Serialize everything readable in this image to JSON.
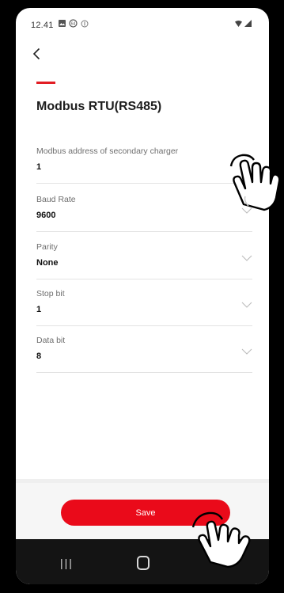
{
  "status_bar": {
    "time": "12.41",
    "icons": [
      "image-icon",
      "data-icon",
      "sync-icon"
    ],
    "signal_icons": [
      "wifi-icon",
      "signal-icon"
    ]
  },
  "header": {
    "back_icon": "back-arrow-icon",
    "title": "Modbus RTU(RS485)",
    "accent_color": "#e21d24"
  },
  "fields": [
    {
      "label": "Modbus address of secondary charger",
      "value": "1",
      "type": "text"
    },
    {
      "label": "Baud Rate",
      "value": "9600",
      "type": "select"
    },
    {
      "label": "Parity",
      "value": "None",
      "type": "select"
    },
    {
      "label": "Stop bit",
      "value": "1",
      "type": "select"
    },
    {
      "label": "Data bit",
      "value": "8",
      "type": "select"
    }
  ],
  "save_button": {
    "label": "Save",
    "color": "#ea0a1a"
  },
  "nav": {
    "recents_icon": "recents-icon",
    "home_icon": "home-icon"
  }
}
